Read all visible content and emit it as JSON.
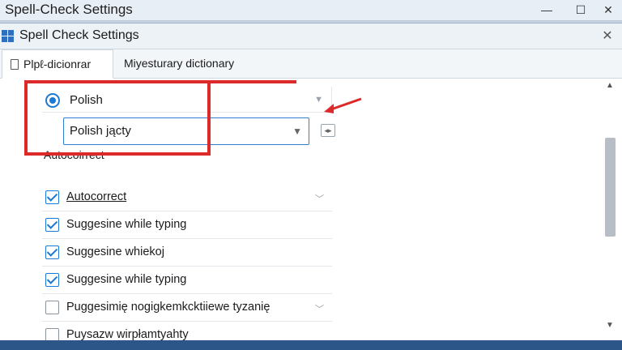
{
  "window": {
    "title": "Spell-Check Settings",
    "minimize": "—",
    "maximize": "☐",
    "close": "✕"
  },
  "dialog": {
    "title": "Spell Check Settings",
    "close": "✕"
  },
  "tabs": [
    {
      "label": "Plpℓ-dicionrar",
      "active": true
    },
    {
      "label": "Miyesturary dictionary",
      "active": false
    }
  ],
  "language": {
    "label": "Polish",
    "selected": true
  },
  "dictionary_select": {
    "value": "Polish jącty"
  },
  "group_label": "Autocoirrect",
  "options": [
    {
      "label": "Autocorrect",
      "checked": true,
      "underlined": true,
      "has_chevron": true
    },
    {
      "label": "Suggesine while typing",
      "checked": true,
      "underlined": false,
      "has_chevron": false
    },
    {
      "label": "Suggesine whiekoj",
      "checked": true,
      "underlined": false,
      "has_chevron": false
    },
    {
      "label": "Suggesine while typing",
      "checked": true,
      "underlined": false,
      "has_chevron": false
    },
    {
      "label": "Puggesimię nogigkemkcktiiewe tyzanię",
      "checked": false,
      "underlined": false,
      "has_chevron": true
    },
    {
      "label": "Puysazw wirpłamtyahty",
      "checked": false,
      "underlined": false,
      "has_chevron": false
    }
  ],
  "colors": {
    "accent": "#1c7ad4",
    "annotation": "#dc2a2a",
    "taskbar": "#2c5588"
  }
}
